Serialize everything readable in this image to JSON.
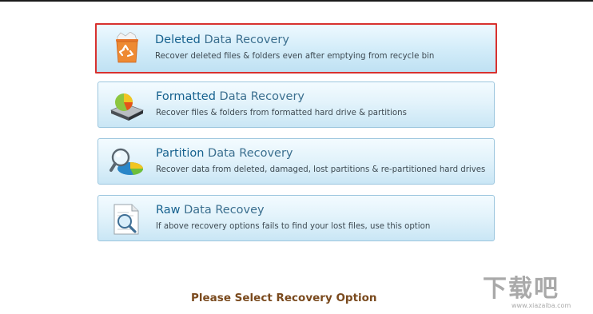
{
  "options": [
    {
      "keyword": "Deleted",
      "rest": " Data Recovery",
      "description": "Recover deleted files & folders even after emptying from recycle bin",
      "icon": "recycle-bin-icon",
      "selected": true
    },
    {
      "keyword": "Formatted",
      "rest": " Data Recovery",
      "description": "Recover files & folders from formatted hard drive & partitions",
      "icon": "hard-drive-pie-icon",
      "selected": false
    },
    {
      "keyword": "Partition",
      "rest": " Data Recovery",
      "description": "Recover data from deleted, damaged, lost partitions  & re-partitioned hard drives",
      "icon": "partition-magnifier-icon",
      "selected": false
    },
    {
      "keyword": "Raw",
      "rest": " Data Recovey",
      "description": "If above recovery options fails to find your lost files, use this option",
      "icon": "document-magnifier-icon",
      "selected": false
    }
  ],
  "prompt": "Please Select Recovery Option",
  "watermark": {
    "text": "下载吧",
    "url": "www.xiazaiba.com"
  },
  "colors": {
    "selection_border": "#d8322f",
    "title_keyword": "#17628f",
    "prompt": "#7a4a1e"
  }
}
